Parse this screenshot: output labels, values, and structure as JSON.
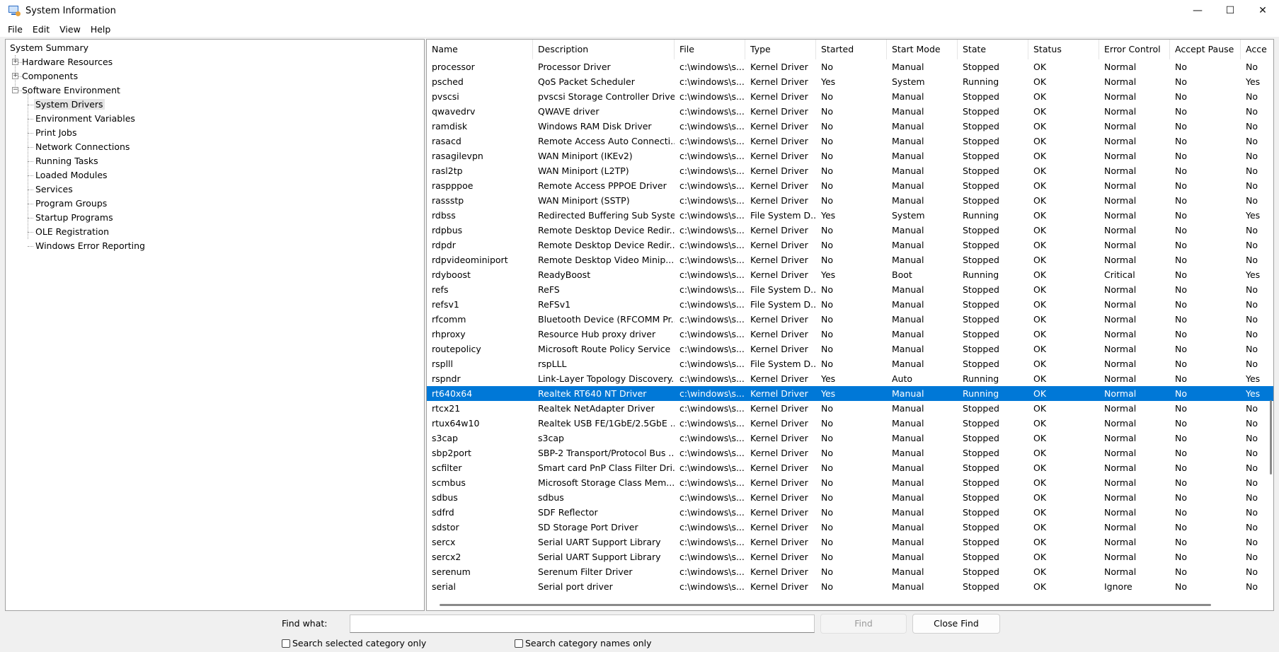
{
  "window": {
    "title": "System Information",
    "minimize": "—",
    "maximize": "☐",
    "close": "✕"
  },
  "menu": [
    "File",
    "Edit",
    "View",
    "Help"
  ],
  "tree": {
    "root": "System Summary",
    "top": [
      {
        "label": "Hardware Resources",
        "toggle": "+"
      },
      {
        "label": "Components",
        "toggle": "+"
      },
      {
        "label": "Software Environment",
        "toggle": "−"
      }
    ],
    "children": [
      "System Drivers",
      "Environment Variables",
      "Print Jobs",
      "Network Connections",
      "Running Tasks",
      "Loaded Modules",
      "Services",
      "Program Groups",
      "Startup Programs",
      "OLE Registration",
      "Windows Error Reporting"
    ],
    "selected_child": 0
  },
  "table": {
    "columns": [
      "Name",
      "Description",
      "File",
      "Type",
      "Started",
      "Start Mode",
      "State",
      "Status",
      "Error Control",
      "Accept Pause",
      "Acce"
    ],
    "selected_row": 22,
    "rows": [
      [
        "processor",
        "Processor Driver",
        "c:\\windows\\s...",
        "Kernel Driver",
        "No",
        "Manual",
        "Stopped",
        "OK",
        "Normal",
        "No",
        "No"
      ],
      [
        "psched",
        "QoS Packet Scheduler",
        "c:\\windows\\s...",
        "Kernel Driver",
        "Yes",
        "System",
        "Running",
        "OK",
        "Normal",
        "No",
        "Yes"
      ],
      [
        "pvscsi",
        "pvscsi Storage Controller Driver",
        "c:\\windows\\s...",
        "Kernel Driver",
        "No",
        "Manual",
        "Stopped",
        "OK",
        "Normal",
        "No",
        "No"
      ],
      [
        "qwavedrv",
        "QWAVE driver",
        "c:\\windows\\s...",
        "Kernel Driver",
        "No",
        "Manual",
        "Stopped",
        "OK",
        "Normal",
        "No",
        "No"
      ],
      [
        "ramdisk",
        "Windows RAM Disk Driver",
        "c:\\windows\\s...",
        "Kernel Driver",
        "No",
        "Manual",
        "Stopped",
        "OK",
        "Normal",
        "No",
        "No"
      ],
      [
        "rasacd",
        "Remote Access Auto Connecti...",
        "c:\\windows\\s...",
        "Kernel Driver",
        "No",
        "Manual",
        "Stopped",
        "OK",
        "Normal",
        "No",
        "No"
      ],
      [
        "rasagilevpn",
        "WAN Miniport (IKEv2)",
        "c:\\windows\\s...",
        "Kernel Driver",
        "No",
        "Manual",
        "Stopped",
        "OK",
        "Normal",
        "No",
        "No"
      ],
      [
        "rasl2tp",
        "WAN Miniport (L2TP)",
        "c:\\windows\\s...",
        "Kernel Driver",
        "No",
        "Manual",
        "Stopped",
        "OK",
        "Normal",
        "No",
        "No"
      ],
      [
        "raspppoe",
        "Remote Access PPPOE Driver",
        "c:\\windows\\s...",
        "Kernel Driver",
        "No",
        "Manual",
        "Stopped",
        "OK",
        "Normal",
        "No",
        "No"
      ],
      [
        "rassstp",
        "WAN Miniport (SSTP)",
        "c:\\windows\\s...",
        "Kernel Driver",
        "No",
        "Manual",
        "Stopped",
        "OK",
        "Normal",
        "No",
        "No"
      ],
      [
        "rdbss",
        "Redirected Buffering Sub Syste...",
        "c:\\windows\\s...",
        "File System D...",
        "Yes",
        "System",
        "Running",
        "OK",
        "Normal",
        "No",
        "Yes"
      ],
      [
        "rdpbus",
        "Remote Desktop Device Redir...",
        "c:\\windows\\s...",
        "Kernel Driver",
        "No",
        "Manual",
        "Stopped",
        "OK",
        "Normal",
        "No",
        "No"
      ],
      [
        "rdpdr",
        "Remote Desktop Device Redir...",
        "c:\\windows\\s...",
        "Kernel Driver",
        "No",
        "Manual",
        "Stopped",
        "OK",
        "Normal",
        "No",
        "No"
      ],
      [
        "rdpvideominiport",
        "Remote Desktop Video Minip...",
        "c:\\windows\\s...",
        "Kernel Driver",
        "No",
        "Manual",
        "Stopped",
        "OK",
        "Normal",
        "No",
        "No"
      ],
      [
        "rdyboost",
        "ReadyBoost",
        "c:\\windows\\s...",
        "Kernel Driver",
        "Yes",
        "Boot",
        "Running",
        "OK",
        "Critical",
        "No",
        "Yes"
      ],
      [
        "refs",
        "ReFS",
        "c:\\windows\\s...",
        "File System D...",
        "No",
        "Manual",
        "Stopped",
        "OK",
        "Normal",
        "No",
        "No"
      ],
      [
        "refsv1",
        "ReFSv1",
        "c:\\windows\\s...",
        "File System D...",
        "No",
        "Manual",
        "Stopped",
        "OK",
        "Normal",
        "No",
        "No"
      ],
      [
        "rfcomm",
        "Bluetooth Device (RFCOMM Pr...",
        "c:\\windows\\s...",
        "Kernel Driver",
        "No",
        "Manual",
        "Stopped",
        "OK",
        "Normal",
        "No",
        "No"
      ],
      [
        "rhproxy",
        "Resource Hub proxy driver",
        "c:\\windows\\s...",
        "Kernel Driver",
        "No",
        "Manual",
        "Stopped",
        "OK",
        "Normal",
        "No",
        "No"
      ],
      [
        "routepolicy",
        "Microsoft Route Policy Service",
        "c:\\windows\\s...",
        "Kernel Driver",
        "No",
        "Manual",
        "Stopped",
        "OK",
        "Normal",
        "No",
        "No"
      ],
      [
        "rsplll",
        "rspLLL",
        "c:\\windows\\s...",
        "File System D...",
        "No",
        "Manual",
        "Stopped",
        "OK",
        "Normal",
        "No",
        "No"
      ],
      [
        "rspndr",
        "Link-Layer Topology Discovery...",
        "c:\\windows\\s...",
        "Kernel Driver",
        "Yes",
        "Auto",
        "Running",
        "OK",
        "Normal",
        "No",
        "Yes"
      ],
      [
        "rt640x64",
        "Realtek RT640 NT Driver",
        "c:\\windows\\s...",
        "Kernel Driver",
        "Yes",
        "Manual",
        "Running",
        "OK",
        "Normal",
        "No",
        "Yes"
      ],
      [
        "rtcx21",
        "Realtek NetAdapter Driver",
        "c:\\windows\\s...",
        "Kernel Driver",
        "No",
        "Manual",
        "Stopped",
        "OK",
        "Normal",
        "No",
        "No"
      ],
      [
        "rtux64w10",
        "Realtek USB FE/1GbE/2.5GbE ...",
        "c:\\windows\\s...",
        "Kernel Driver",
        "No",
        "Manual",
        "Stopped",
        "OK",
        "Normal",
        "No",
        "No"
      ],
      [
        "s3cap",
        "s3cap",
        "c:\\windows\\s...",
        "Kernel Driver",
        "No",
        "Manual",
        "Stopped",
        "OK",
        "Normal",
        "No",
        "No"
      ],
      [
        "sbp2port",
        "SBP-2 Transport/Protocol Bus ...",
        "c:\\windows\\s...",
        "Kernel Driver",
        "No",
        "Manual",
        "Stopped",
        "OK",
        "Normal",
        "No",
        "No"
      ],
      [
        "scfilter",
        "Smart card PnP Class Filter Dri...",
        "c:\\windows\\s...",
        "Kernel Driver",
        "No",
        "Manual",
        "Stopped",
        "OK",
        "Normal",
        "No",
        "No"
      ],
      [
        "scmbus",
        "Microsoft Storage Class Mem...",
        "c:\\windows\\s...",
        "Kernel Driver",
        "No",
        "Manual",
        "Stopped",
        "OK",
        "Normal",
        "No",
        "No"
      ],
      [
        "sdbus",
        "sdbus",
        "c:\\windows\\s...",
        "Kernel Driver",
        "No",
        "Manual",
        "Stopped",
        "OK",
        "Normal",
        "No",
        "No"
      ],
      [
        "sdfrd",
        "SDF Reflector",
        "c:\\windows\\s...",
        "Kernel Driver",
        "No",
        "Manual",
        "Stopped",
        "OK",
        "Normal",
        "No",
        "No"
      ],
      [
        "sdstor",
        "SD Storage Port Driver",
        "c:\\windows\\s...",
        "Kernel Driver",
        "No",
        "Manual",
        "Stopped",
        "OK",
        "Normal",
        "No",
        "No"
      ],
      [
        "sercx",
        "Serial UART Support Library",
        "c:\\windows\\s...",
        "Kernel Driver",
        "No",
        "Manual",
        "Stopped",
        "OK",
        "Normal",
        "No",
        "No"
      ],
      [
        "sercx2",
        "Serial UART Support Library",
        "c:\\windows\\s...",
        "Kernel Driver",
        "No",
        "Manual",
        "Stopped",
        "OK",
        "Normal",
        "No",
        "No"
      ],
      [
        "serenum",
        "Serenum Filter Driver",
        "c:\\windows\\s...",
        "Kernel Driver",
        "No",
        "Manual",
        "Stopped",
        "OK",
        "Normal",
        "No",
        "No"
      ],
      [
        "serial",
        "Serial port driver",
        "c:\\windows\\s...",
        "Kernel Driver",
        "No",
        "Manual",
        "Stopped",
        "OK",
        "Ignore",
        "No",
        "No"
      ]
    ]
  },
  "find": {
    "label": "Find what:",
    "value": "",
    "find_button": "Find",
    "close_button": "Close Find",
    "check_selected": "Search selected category only",
    "check_names": "Search category names only"
  },
  "colors": {
    "selection": "#0078d7",
    "selection_text": "#ffffff"
  }
}
